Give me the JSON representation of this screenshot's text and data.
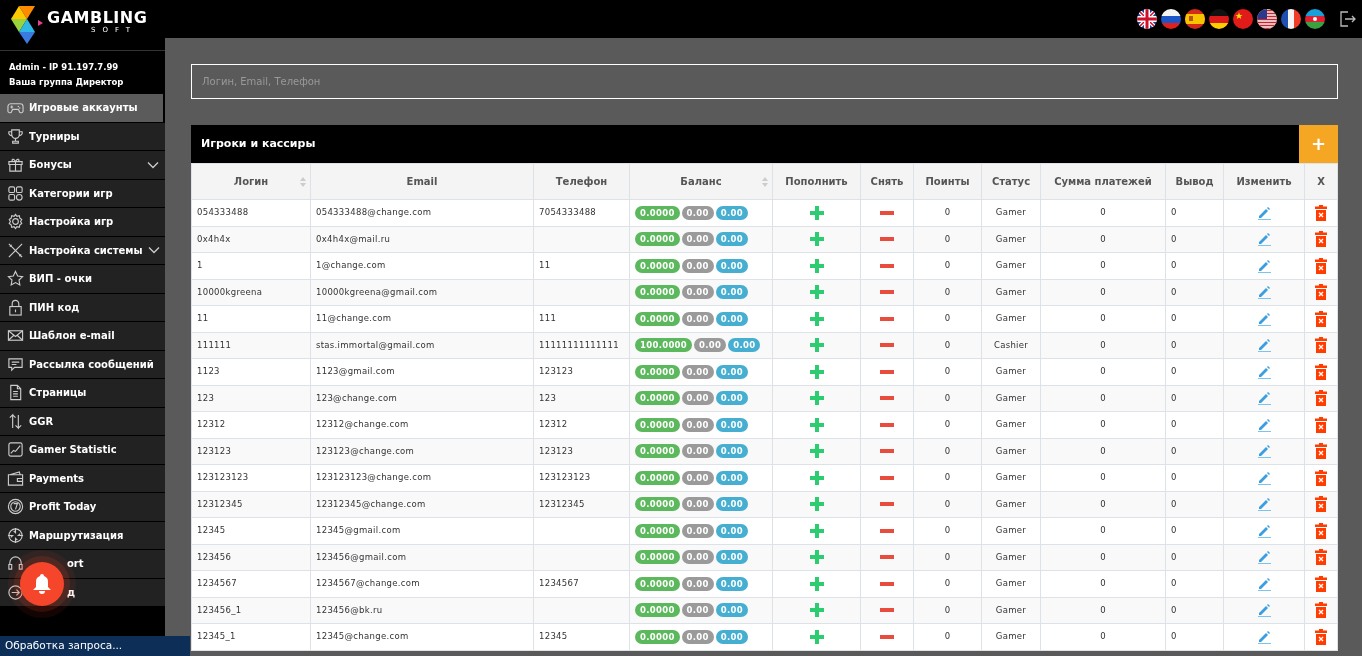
{
  "brand": {
    "name": "GAMBLING",
    "tagline": "SOFT"
  },
  "user": {
    "line": "Admin - IP 91.197.7.99",
    "group": "Ваша группа Директор"
  },
  "sidebar": {
    "items": [
      {
        "label": "Игровые аккаунты",
        "selected": true,
        "submenu": false
      },
      {
        "label": "Турниры",
        "selected": false,
        "submenu": false
      },
      {
        "label": "Бонусы",
        "selected": false,
        "submenu": true
      },
      {
        "label": "Категории игр",
        "selected": false,
        "submenu": false
      },
      {
        "label": "Настройка игр",
        "selected": false,
        "submenu": false
      },
      {
        "label": "Настройка системы",
        "selected": false,
        "submenu": true
      },
      {
        "label": "ВИП - очки",
        "selected": false,
        "submenu": false
      },
      {
        "label": "ПИН код",
        "selected": false,
        "submenu": false
      },
      {
        "label": "Шаблон e-mail",
        "selected": false,
        "submenu": false
      },
      {
        "label": "Рассылка сообщений",
        "selected": false,
        "submenu": false
      },
      {
        "label": "Страницы",
        "selected": false,
        "submenu": false
      },
      {
        "label": "GGR",
        "selected": false,
        "submenu": false
      },
      {
        "label": "Gamer Statistic",
        "selected": false,
        "submenu": false
      },
      {
        "label": "Payments",
        "selected": false,
        "submenu": false
      },
      {
        "label": "Profit Today",
        "selected": false,
        "submenu": false
      },
      {
        "label": "Маршрутизация",
        "selected": false,
        "submenu": false
      },
      {
        "label": "ort",
        "selected": false,
        "submenu": false
      },
      {
        "label": "д",
        "selected": false,
        "submenu": false
      }
    ]
  },
  "search": {
    "placeholder": "Логин, Email, Телефон"
  },
  "players_table": {
    "title": "Игроки и кассиры",
    "add_button": "+",
    "columns": [
      {
        "label": "Логин",
        "sortable": true
      },
      {
        "label": "Email",
        "sortable": false
      },
      {
        "label": "Телефон",
        "sortable": false
      },
      {
        "label": "Баланс",
        "sortable": true
      },
      {
        "label": "Пополнить",
        "sortable": false
      },
      {
        "label": "Снять",
        "sortable": false
      },
      {
        "label": "Поинты",
        "sortable": false
      },
      {
        "label": "Статус",
        "sortable": false
      },
      {
        "label": "Сумма платежей",
        "sortable": false
      },
      {
        "label": "Вывод",
        "sortable": false
      },
      {
        "label": "Изменить",
        "sortable": false
      },
      {
        "label": "X",
        "sortable": false
      }
    ],
    "rows": [
      {
        "login": "054333488",
        "email": "054333488@change.com",
        "phone": "7054333488",
        "balance": [
          "0.0000",
          "0.00",
          "0.00"
        ],
        "points": "0",
        "status": "Gamer",
        "payments": "0",
        "withdrawal": "0"
      },
      {
        "login": "0x4h4x",
        "email": "0x4h4x@mail.ru",
        "balance": [
          "0.0000",
          "0.00",
          "0.00"
        ],
        "points": "0",
        "status": "Gamer",
        "payments": "0",
        "withdrawal": "0"
      },
      {
        "login": "1",
        "email": "1@change.com",
        "phone": "11",
        "balance": [
          "0.0000",
          "0.00",
          "0.00"
        ],
        "points": "0",
        "status": "Gamer",
        "payments": "0",
        "withdrawal": "0"
      },
      {
        "login": "10000kgreena",
        "email": "10000kgreena@gmail.com",
        "balance": [
          "0.0000",
          "0.00",
          "0.00"
        ],
        "points": "0",
        "status": "Gamer",
        "payments": "0",
        "withdrawal": "0"
      },
      {
        "login": "11",
        "email": "11@change.com",
        "phone": "111",
        "balance": [
          "0.0000",
          "0.00",
          "0.00"
        ],
        "points": "0",
        "status": "Gamer",
        "payments": "0",
        "withdrawal": "0"
      },
      {
        "login": "111111",
        "email": "stas.immortal@gmail.com",
        "phone": "11111111111111",
        "balance": [
          "100.0000",
          "0.00",
          "0.00"
        ],
        "points": "0",
        "status": "Cashier",
        "payments": "0",
        "withdrawal": "0"
      },
      {
        "login": "1123",
        "email": "1123@gmail.com",
        "phone": "123123",
        "balance": [
          "0.0000",
          "0.00",
          "0.00"
        ],
        "points": "0",
        "status": "Gamer",
        "payments": "0",
        "withdrawal": "0"
      },
      {
        "login": "123",
        "email": "123@change.com",
        "phone": "123",
        "balance": [
          "0.0000",
          "0.00",
          "0.00"
        ],
        "points": "0",
        "status": "Gamer",
        "payments": "0",
        "withdrawal": "0"
      },
      {
        "login": "12312",
        "email": "12312@change.com",
        "phone": "12312",
        "balance": [
          "0.0000",
          "0.00",
          "0.00"
        ],
        "points": "0",
        "status": "Gamer",
        "payments": "0",
        "withdrawal": "0"
      },
      {
        "login": "123123",
        "email": "123123@change.com",
        "phone": "123123",
        "balance": [
          "0.0000",
          "0.00",
          "0.00"
        ],
        "points": "0",
        "status": "Gamer",
        "payments": "0",
        "withdrawal": "0"
      },
      {
        "login": "123123123",
        "email": "123123123@change.com",
        "phone": "123123123",
        "balance": [
          "0.0000",
          "0.00",
          "0.00"
        ],
        "points": "0",
        "status": "Gamer",
        "payments": "0",
        "withdrawal": "0"
      },
      {
        "login": "12312345",
        "email": "12312345@change.com",
        "phone": "12312345",
        "balance": [
          "0.0000",
          "0.00",
          "0.00"
        ],
        "points": "0",
        "status": "Gamer",
        "payments": "0",
        "withdrawal": "0"
      },
      {
        "login": "12345",
        "email": "12345@gmail.com",
        "balance": [
          "0.0000",
          "0.00",
          "0.00"
        ],
        "points": "0",
        "status": "Gamer",
        "payments": "0",
        "withdrawal": "0"
      },
      {
        "login": "123456",
        "email": "123456@gmail.com",
        "balance": [
          "0.0000",
          "0.00",
          "0.00"
        ],
        "points": "0",
        "status": "Gamer",
        "payments": "0",
        "withdrawal": "0"
      },
      {
        "login": "1234567",
        "email": "1234567@change.com",
        "phone": "1234567",
        "balance": [
          "0.0000",
          "0.00",
          "0.00"
        ],
        "points": "0",
        "status": "Gamer",
        "payments": "0",
        "withdrawal": "0"
      },
      {
        "login": "123456_1",
        "email": "123456@bk.ru",
        "balance": [
          "0.0000",
          "0.00",
          "0.00"
        ],
        "points": "0",
        "status": "Gamer",
        "payments": "0",
        "withdrawal": "0"
      },
      {
        "login": "12345_1",
        "email": "12345@change.com",
        "phone": "12345",
        "balance": [
          "0.0000",
          "0.00",
          "0.00"
        ],
        "points": "0",
        "status": "Gamer",
        "payments": "0",
        "withdrawal": "0"
      }
    ]
  },
  "status_bar": {
    "text": "Обработка запроса..."
  }
}
